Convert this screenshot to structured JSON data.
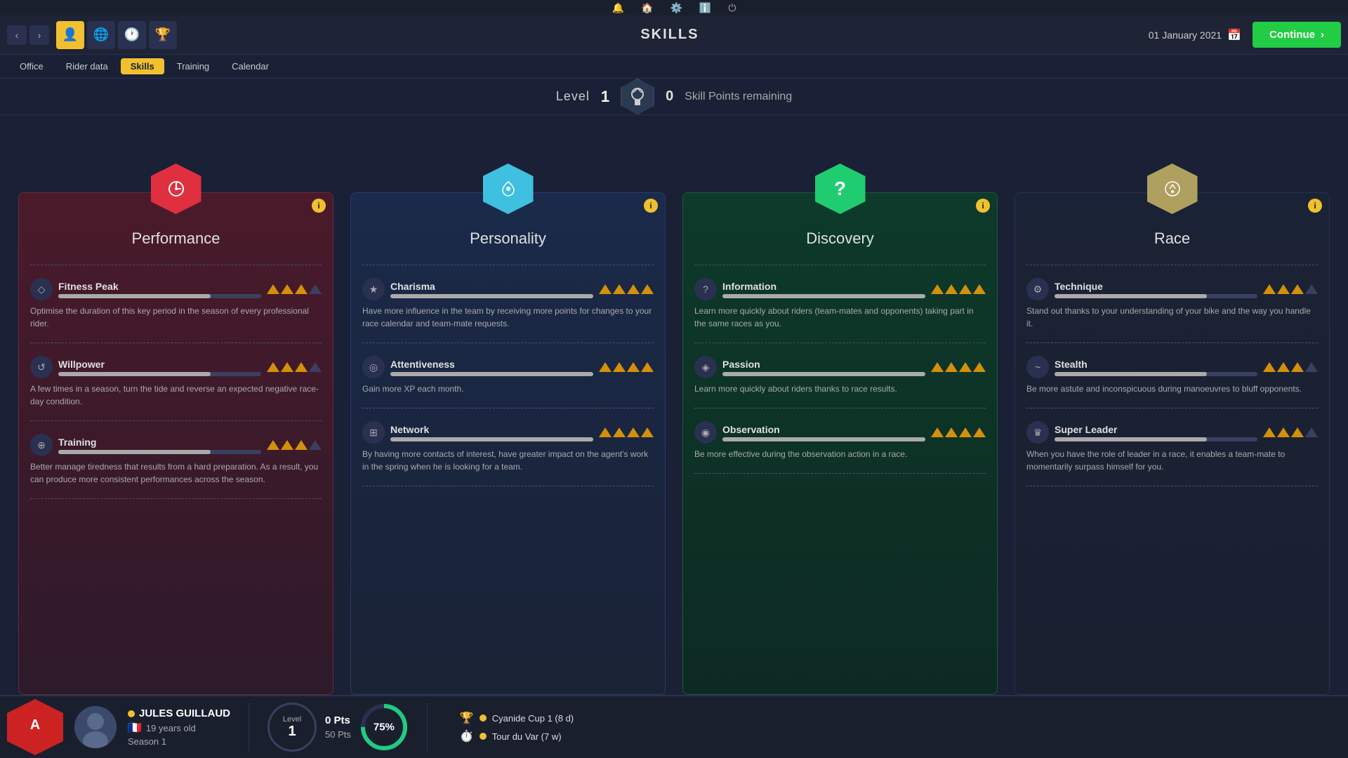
{
  "topNav": {
    "icons": [
      "🔔",
      "🏠",
      "⚙️",
      "ℹ️",
      "⏻"
    ]
  },
  "secondBar": {
    "title": "SKILLS",
    "date": "01 January 2021",
    "continueLabel": "Continue"
  },
  "subTabs": [
    {
      "label": "Office",
      "active": false
    },
    {
      "label": "Rider data",
      "active": false
    },
    {
      "label": "Skills",
      "active": true
    },
    {
      "label": "Training",
      "active": false
    },
    {
      "label": "Calendar",
      "active": false
    }
  ],
  "levelBar": {
    "levelLabel": "Level",
    "levelNum": "1",
    "skillPointsNum": "0",
    "skillPointsLabel": "Skill Points remaining"
  },
  "cards": [
    {
      "id": "performance",
      "title": "Performance",
      "hexColor": "performance",
      "hexIcon": "⏱️",
      "skills": [
        {
          "name": "Fitness Peak",
          "bars": 3,
          "maxBars": 4,
          "desc": "Optimise the duration of this key period in the season of every professional rider.",
          "icon": "◇"
        },
        {
          "name": "Willpower",
          "bars": 3,
          "maxBars": 4,
          "desc": "A few times in a season, turn the tide and reverse an expected negative race-day condition.",
          "icon": "↺"
        },
        {
          "name": "Training",
          "bars": 3,
          "maxBars": 4,
          "desc": "Better manage tiredness that results from a hard preparation. As a result, you can produce more consistent performances across the season.",
          "icon": "⊕"
        }
      ]
    },
    {
      "id": "personality",
      "title": "Personality",
      "hexColor": "personality",
      "hexIcon": "✦",
      "skills": [
        {
          "name": "Charisma",
          "bars": 4,
          "maxBars": 4,
          "desc": "Have more influence in the team by receiving more points for changes to your race calendar and team-mate requests.",
          "icon": "★"
        },
        {
          "name": "Attentiveness",
          "bars": 4,
          "maxBars": 4,
          "desc": "Gain more XP each month.",
          "icon": "◎"
        },
        {
          "name": "Network",
          "bars": 4,
          "maxBars": 4,
          "desc": "By having more contacts of interest, have greater impact on the agent's work in the spring when he is looking for a team.",
          "icon": "⊞"
        }
      ]
    },
    {
      "id": "discovery",
      "title": "Discovery",
      "hexColor": "discovery",
      "hexIcon": "?",
      "skills": [
        {
          "name": "Information",
          "bars": 4,
          "maxBars": 4,
          "desc": "Learn more quickly about riders (team-mates and opponents) taking part in the same races as you.",
          "icon": "?"
        },
        {
          "name": "Passion",
          "bars": 4,
          "maxBars": 4,
          "desc": "Learn more quickly about riders thanks to race results.",
          "icon": "◈"
        },
        {
          "name": "Observation",
          "bars": 4,
          "maxBars": 4,
          "desc": "Be more effective during the observation action in a race.",
          "icon": "◉"
        }
      ]
    },
    {
      "id": "race",
      "title": "Race",
      "hexColor": "race",
      "hexIcon": "⟳",
      "skills": [
        {
          "name": "Technique",
          "bars": 3,
          "maxBars": 4,
          "desc": "Stand out thanks to your understanding of your bike and the way you handle it.",
          "icon": "⚙"
        },
        {
          "name": "Stealth",
          "bars": 3,
          "maxBars": 4,
          "desc": "Be more astute and inconspicuous during manoeuvres to bluff opponents.",
          "icon": "~"
        },
        {
          "name": "Super Leader",
          "bars": 3,
          "maxBars": 4,
          "desc": "When you have the role of leader in a race, it enables a team-mate to momentarily surpass himself for you.",
          "icon": "👑"
        }
      ]
    }
  ],
  "bottomBar": {
    "playerName": "JULES GUILLAUD",
    "playerAge": "19 years old",
    "playerSeason": "Season 1",
    "levelLabel": "Level",
    "levelNum": "1",
    "pts": "0 Pts",
    "totalPts": "50 Pts",
    "progressPercent": "75%",
    "races": [
      {
        "icon": "🏆",
        "label": "Cyanide Cup 1 (8 d)"
      },
      {
        "icon": "⏱️",
        "label": "Tour du Var (7 w)"
      }
    ]
  }
}
